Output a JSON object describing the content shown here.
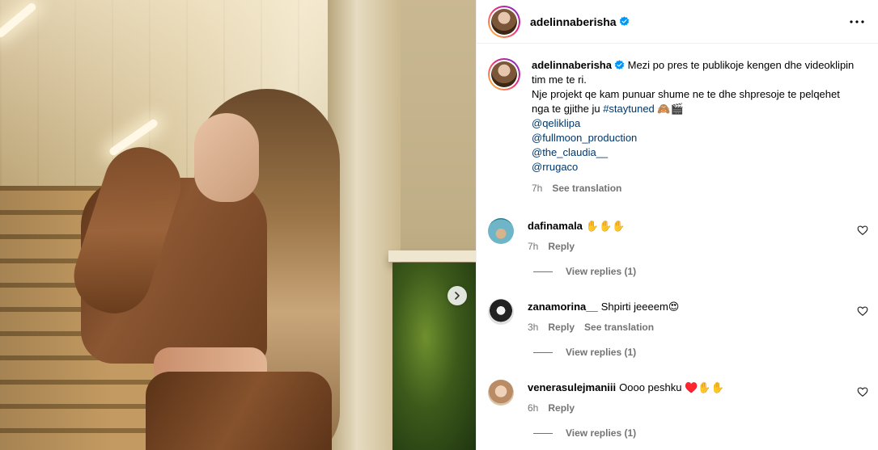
{
  "post": {
    "username": "adelinnaberisha",
    "verified": true,
    "more_icon": "more-horizontal-icon"
  },
  "caption": {
    "username": "adelinnaberisha",
    "line1": "Mezi po pres te publikoje kengen dhe videoklipin tim me te ri.",
    "line2": "Nje projekt qe kam punuar shume ne te dhe shpresoje te pelqehet nga te gjithe ju ",
    "hashtag": "#staytuned",
    "emojis": "🙈🎬",
    "mentions": [
      "@qeliklipa",
      "@fullmoon_production",
      "@the_claudia__",
      "@rrugaco"
    ],
    "time": "7h",
    "see_translation": "See translation"
  },
  "comments": [
    {
      "username": "dafinamala",
      "text": "✋✋✋",
      "time": "7h",
      "reply": "Reply",
      "see_translation": "",
      "view_replies": "View replies (1)"
    },
    {
      "username": "zanamorina__",
      "text": "Shpirti jeeeem😍",
      "time": "3h",
      "reply": "Reply",
      "see_translation": "See translation",
      "view_replies": "View replies (1)"
    },
    {
      "username": "venerasulejmaniii",
      "text": "Oooo peshku ♥️✋✋",
      "time": "6h",
      "reply": "Reply",
      "see_translation": "",
      "view_replies": "View replies (1)"
    }
  ],
  "colors": {
    "link": "#00376b",
    "muted": "#737373",
    "verified": "#0095f6",
    "story_ring_start": "#f9ce34",
    "story_ring_mid": "#ee2a7b",
    "story_ring_end": "#6228d7"
  }
}
